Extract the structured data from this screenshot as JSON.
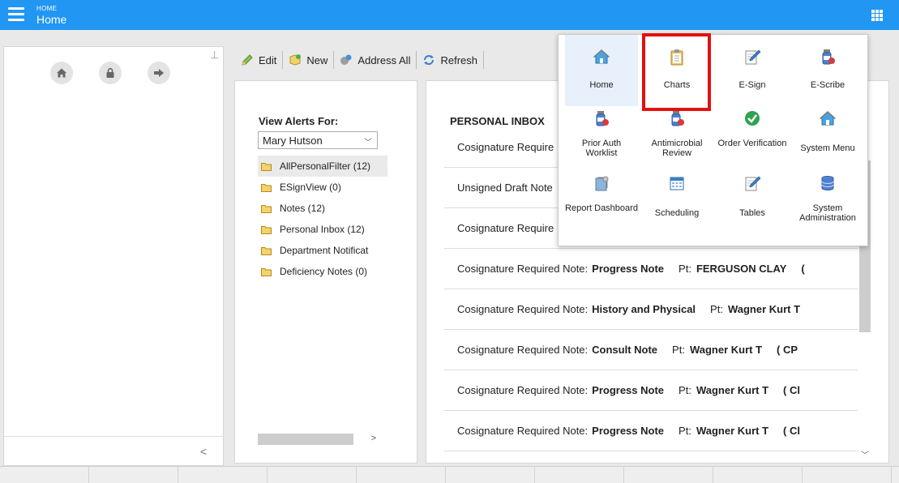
{
  "header": {
    "breadcrumb_small": "HOME",
    "breadcrumb_title": "Home",
    "accent": "#2196f3"
  },
  "left_nav": {
    "icons": [
      "home-icon",
      "lock-icon",
      "sign-out-icon"
    ]
  },
  "toolbar": {
    "edit": "Edit",
    "new": "New",
    "address_all": "Address All",
    "refresh": "Refresh"
  },
  "alerts": {
    "title": "View Alerts For:",
    "selected_user": "Mary Hutson",
    "folders": [
      "AllPersonalFilter (12)",
      "ESignView (0)",
      "Notes (12)",
      "Personal Inbox (12)",
      "Department Notificat",
      "Deficiency Notes (0)"
    ]
  },
  "inbox": {
    "title": "PERSONAL INBOX",
    "rows": [
      {
        "type": "Cosignature Require",
        "note": "",
        "pt_label": "",
        "patient": "",
        "extra": ""
      },
      {
        "type": "Unsigned Draft Note",
        "note": "",
        "pt_label": "",
        "patient": "",
        "extra": ""
      },
      {
        "type": "Cosignature Require",
        "note": "",
        "pt_label": "",
        "patient": "",
        "extra": ""
      },
      {
        "type": "Cosignature Required Note:",
        "note": "Progress Note",
        "pt_label": "Pt:",
        "patient": "FERGUSON CLAY",
        "extra": "("
      },
      {
        "type": "Cosignature Required Note:",
        "note": "History and Physical",
        "pt_label": "Pt:",
        "patient": "Wagner Kurt T",
        "extra": ""
      },
      {
        "type": "Cosignature Required Note:",
        "note": "Consult Note",
        "pt_label": "Pt:",
        "patient": "Wagner Kurt T",
        "extra": "( CP"
      },
      {
        "type": "Cosignature Required Note:",
        "note": "Progress Note",
        "pt_label": "Pt:",
        "patient": "Wagner Kurt T",
        "extra": "( Cl"
      },
      {
        "type": "Cosignature Required Note:",
        "note": "Progress Note",
        "pt_label": "Pt:",
        "patient": "Wagner Kurt T",
        "extra": "( Cl"
      }
    ]
  },
  "launcher": {
    "tiles": [
      {
        "label": "Home",
        "icon": "home-icon"
      },
      {
        "label": "Charts",
        "icon": "clipboard-icon"
      },
      {
        "label": "E-Sign",
        "icon": "pen-paper-icon"
      },
      {
        "label": "E-Scribe",
        "icon": "pill-bottle-icon"
      },
      {
        "label": "Prior Auth Worklist",
        "icon": "pill-bottle-icon"
      },
      {
        "label": "Antimicrobial Review",
        "icon": "pill-bottle-icon"
      },
      {
        "label": "Order Verification",
        "icon": "check-icon"
      },
      {
        "label": "System Menu",
        "icon": "home-icon"
      },
      {
        "label": "Report Dashboard",
        "icon": "report-icon"
      },
      {
        "label": "Scheduling",
        "icon": "calendar-icon"
      },
      {
        "label": "Tables",
        "icon": "pen-paper-icon"
      },
      {
        "label": "System Administration",
        "icon": "database-icon"
      }
    ]
  }
}
